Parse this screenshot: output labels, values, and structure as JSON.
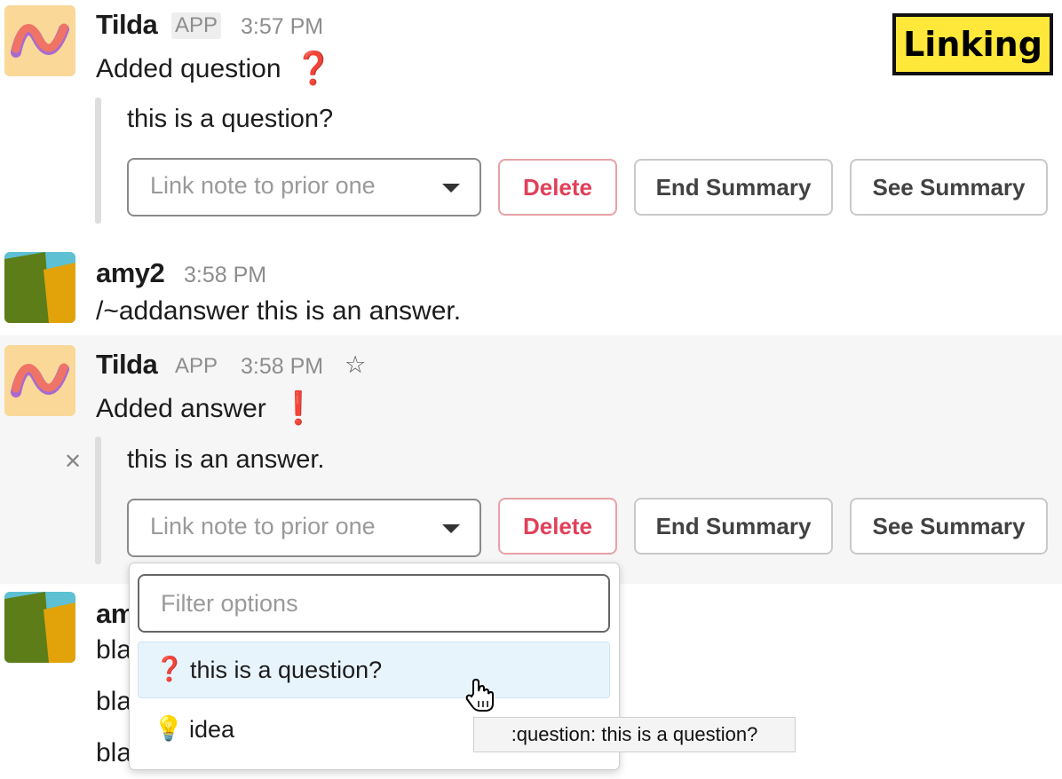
{
  "tag_label": "Linking",
  "messages": [
    {
      "author": "Tilda",
      "badge": "APP",
      "time": "3:57 PM",
      "text": "Added question",
      "emoji": "❓",
      "quote": "this is a question?"
    },
    {
      "author": "amy2",
      "time": "3:58 PM",
      "text": "/~addanswer this is an answer."
    },
    {
      "author": "Tilda",
      "badge": "APP",
      "time": "3:58 PM",
      "text": "Added answer",
      "emoji": "❗",
      "quote": "this is an answer."
    },
    {
      "author": "am",
      "lines": [
        "bla",
        "bla",
        "bla"
      ]
    }
  ],
  "actions": {
    "select_placeholder": "Link note to prior one",
    "delete": "Delete",
    "end_summary": "End Summary",
    "see_summary": "See Summary"
  },
  "dropdown": {
    "filter_placeholder": "Filter options",
    "options": [
      {
        "icon": "question-icon",
        "glyph": "❓",
        "label": "this is a question?"
      },
      {
        "icon": "lightbulb-icon",
        "glyph": "💡",
        "label": "idea"
      }
    ]
  },
  "tooltip": ":question: this is a question?",
  "colors": {
    "delete": "#e0405a",
    "highlight_bg": "#f6f6f6",
    "tag_bg": "#ffe839",
    "option_hover": "#e8f4fc"
  }
}
